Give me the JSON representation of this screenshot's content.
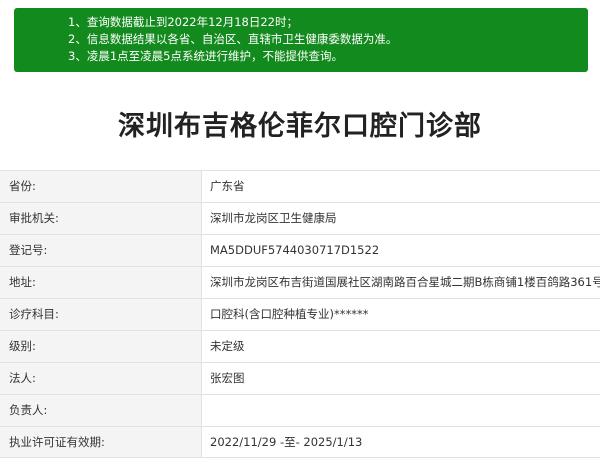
{
  "notice": {
    "lines": [
      "1、查询数据截止到2022年12月18日22时；",
      "2、信息数据结果以各省、自治区、直辖市卫生健康委数据为准。",
      "3、凌晨1点至凌晨5点系统进行维护，不能提供查询。"
    ],
    "background_color": "#138a1e"
  },
  "clinic": {
    "name": "深圳布吉格伦菲尔口腔门诊部"
  },
  "fields": [
    {
      "label": "省份:",
      "value": "广东省"
    },
    {
      "label": "审批机关:",
      "value": "深圳市龙岗区卫生健康局"
    },
    {
      "label": "登记号:",
      "value": "MA5DDUF5744030717D1522"
    },
    {
      "label": "地址:",
      "value": "深圳市龙岗区布吉街道国展社区湖南路百合星城二期B栋商铺1楼百鸽路361号"
    },
    {
      "label": "诊疗科目:",
      "value": "口腔科(含口腔种植专业)******"
    },
    {
      "label": "级别:",
      "value": "未定级"
    },
    {
      "label": "法人:",
      "value": "张宏图"
    },
    {
      "label": "负责人:",
      "value": ""
    },
    {
      "label": "执业许可证有效期:",
      "value": "2022/11/29 -至- 2025/1/13"
    }
  ]
}
